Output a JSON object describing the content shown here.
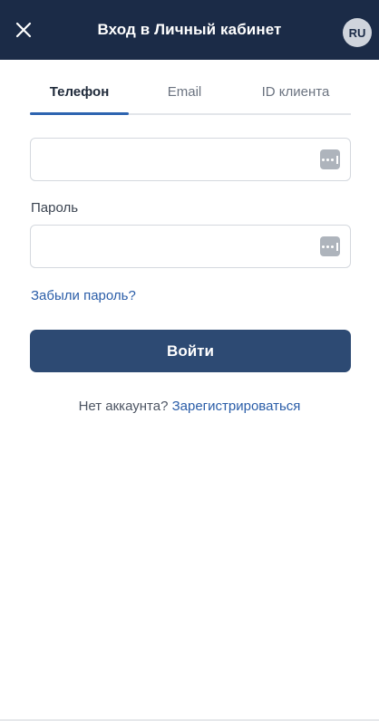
{
  "header": {
    "title": "Вход в Личный кабинет",
    "close_icon": "close-icon",
    "lang": "RU"
  },
  "tabs": [
    {
      "label": "Телефон",
      "active": true
    },
    {
      "label": "Email",
      "active": false
    },
    {
      "label": "ID клиента",
      "active": false
    }
  ],
  "form": {
    "phone_value": "",
    "password_label": "Пароль",
    "password_value": "",
    "forgot_link": "Забыли пароль?",
    "submit_label": "Войти",
    "autofill_icon": "password-manager-icon"
  },
  "footer": {
    "no_account_text": "Нет аккаунта?",
    "register_link": "Зарегистрироваться"
  },
  "colors": {
    "header_bg": "#1b2b47",
    "accent": "#2e64b0",
    "button_bg": "#2d4a73",
    "link": "#2a5da8"
  }
}
